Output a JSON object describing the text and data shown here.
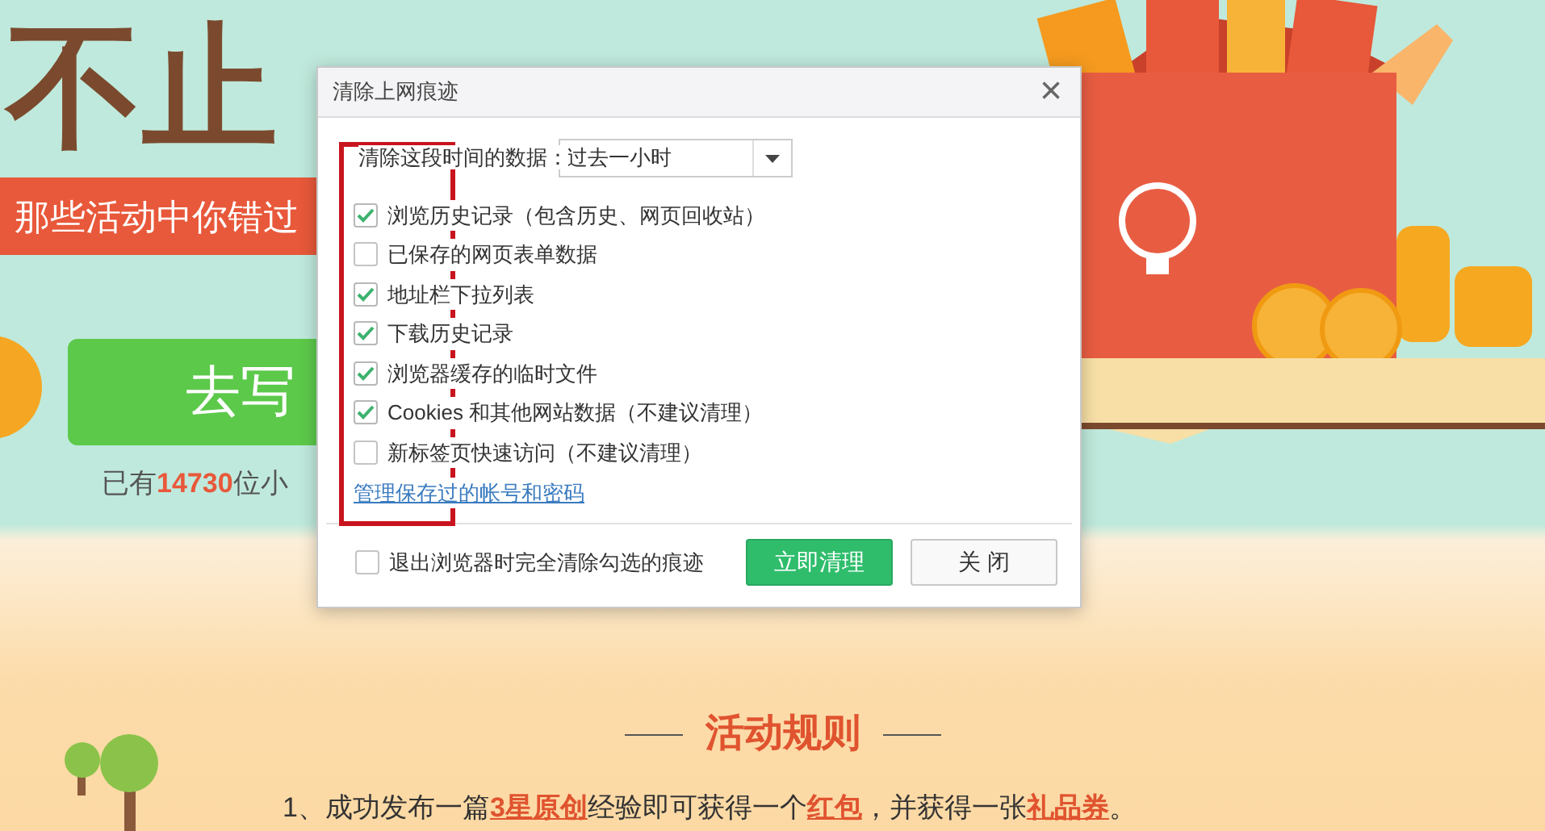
{
  "page": {
    "headline": "不止",
    "banner": "那些活动中你错过",
    "write_button": "去写",
    "participants": "已有**14730**位小",
    "rules_title": "活动规则",
    "rules": [
      "1、成功发布一篇**3星原创**经验即可获得一个**红包**，并获得一张**礼品券**。"
    ]
  },
  "dialog": {
    "title": "清除上网痕迹",
    "close": "×",
    "range_label": "清除这段时间的数据：",
    "range_value": "过去一小时",
    "options": [
      {
        "label": "浏览历史记录（包含历史、网页回收站）",
        "checked": true
      },
      {
        "label": "已保存的网页表单数据",
        "checked": false
      },
      {
        "label": "地址栏下拉列表",
        "checked": true
      },
      {
        "label": "下载历史记录",
        "checked": true
      },
      {
        "label": "浏览器缓存的临时文件",
        "checked": true
      },
      {
        "label": "Cookies 和其他网站数据（不建议清理）",
        "checked": true
      },
      {
        "label": "新标签页快速访问（不建议清理）",
        "checked": false
      }
    ],
    "manage_link": "管理保存过的帐号和密码",
    "clear_on_exit": {
      "label": "退出浏览器时完全清除勾选的痕迹",
      "checked": false
    },
    "buttons": [
      {
        "label": "立即清理",
        "kind": "primary"
      },
      {
        "label": "关 闭",
        "kind": "secondary"
      }
    ]
  }
}
